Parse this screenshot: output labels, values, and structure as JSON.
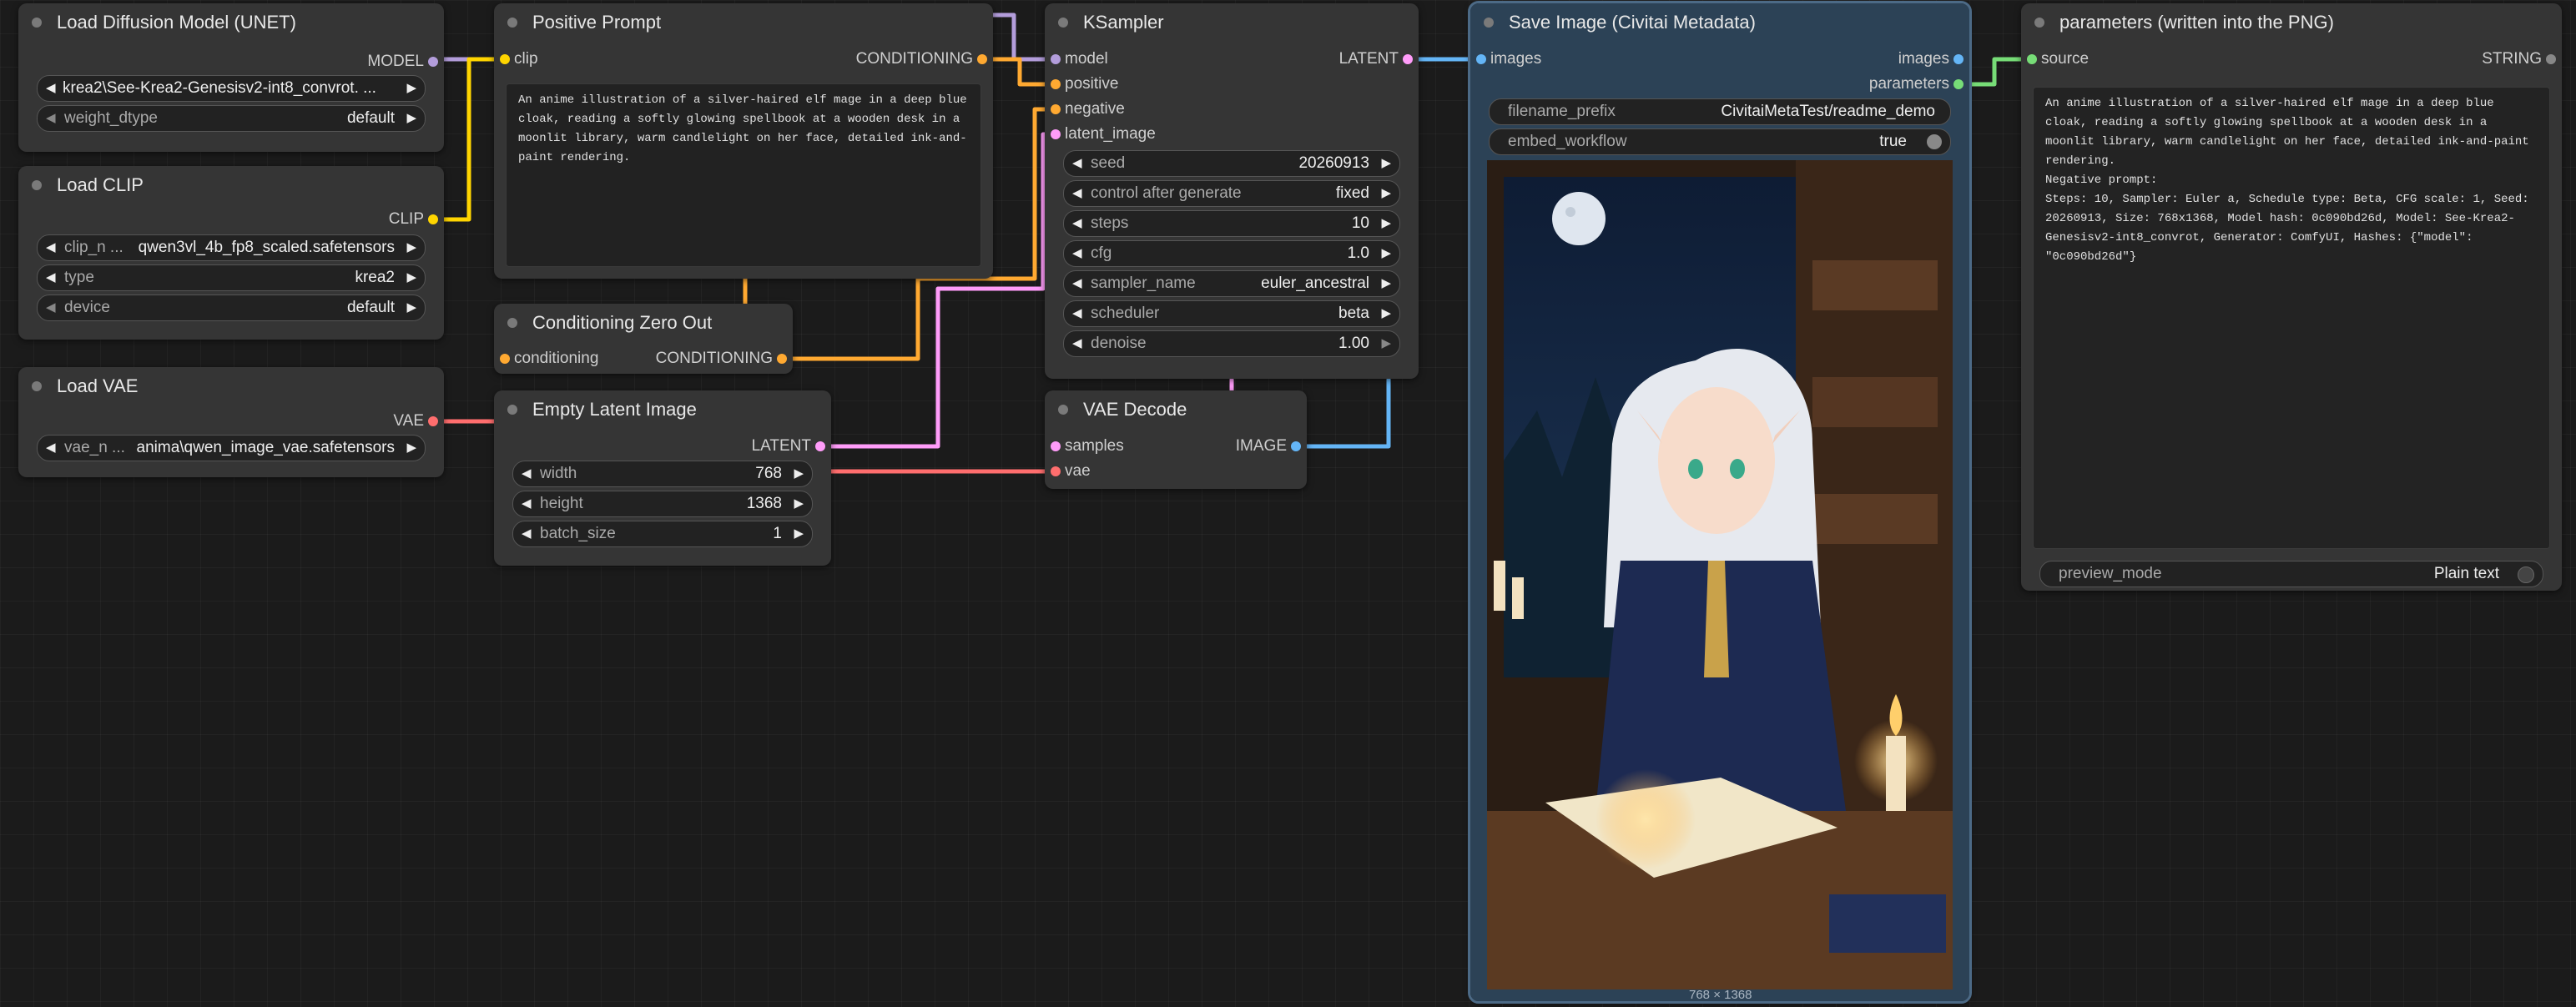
{
  "nodes": {
    "load_unet": {
      "title": "Load Diffusion Model (UNET)",
      "output": "MODEL",
      "unet_name": "krea2\\See-Krea2-Genesisv2-int8_convrot.  ...",
      "weight_dtype": {
        "label": "weight_dtype",
        "value": "default"
      }
    },
    "load_clip": {
      "title": "Load CLIP",
      "output": "CLIP",
      "clip_name": {
        "label": "clip_n ...",
        "value": "qwen3vl_4b_fp8_scaled.safetensors"
      },
      "type": {
        "label": "type",
        "value": "krea2"
      },
      "device": {
        "label": "device",
        "value": "default"
      }
    },
    "load_vae": {
      "title": "Load VAE",
      "output": "VAE",
      "vae_name": {
        "label": "vae_n ...",
        "value": "anima\\qwen_image_vae.safetensors"
      }
    },
    "positive_prompt": {
      "title": "Positive Prompt",
      "input": "clip",
      "output": "CONDITIONING",
      "text": "An anime illustration of a silver-haired elf mage in a deep blue cloak, reading a softly glowing spellbook at a wooden desk in a moonlit library, warm candlelight on her face, detailed ink-and-paint rendering."
    },
    "cond_zero": {
      "title": "Conditioning Zero Out",
      "input": "conditioning",
      "output": "CONDITIONING"
    },
    "empty_latent": {
      "title": "Empty Latent Image",
      "output": "LATENT",
      "width": {
        "label": "width",
        "value": "768"
      },
      "height": {
        "label": "height",
        "value": "1368"
      },
      "batch_size": {
        "label": "batch_size",
        "value": "1"
      }
    },
    "ksampler": {
      "title": "KSampler",
      "inputs": [
        "model",
        "positive",
        "negative",
        "latent_image"
      ],
      "output": "LATENT",
      "widgets": [
        {
          "label": "seed",
          "value": "20260913"
        },
        {
          "label": "control after generate",
          "value": "fixed"
        },
        {
          "label": "steps",
          "value": "10"
        },
        {
          "label": "cfg",
          "value": "1.0"
        },
        {
          "label": "sampler_name",
          "value": "euler_ancestral"
        },
        {
          "label": "scheduler",
          "value": "beta"
        },
        {
          "label": "denoise",
          "value": "1.00"
        }
      ]
    },
    "vae_decode": {
      "title": "VAE Decode",
      "inputs": [
        "samples",
        "vae"
      ],
      "output": "IMAGE"
    },
    "save_image": {
      "title": "Save Image (Civitai Metadata)",
      "input": "images",
      "outputs": [
        "images",
        "parameters"
      ],
      "filename_prefix": {
        "label": "filename_prefix",
        "value": "CivitaiMetaTest/readme_demo"
      },
      "embed_workflow": {
        "label": "embed_workflow",
        "value": "true"
      },
      "image_caption": "768 × 1368"
    },
    "parameters": {
      "title": "parameters (written into the PNG)",
      "input": "source",
      "output": "STRING",
      "text": "An anime illustration of a silver-haired elf mage in a deep blue cloak, reading a softly glowing spellbook at a wooden desk in a moonlit library, warm candlelight on her face, detailed ink-and-paint rendering.\nNegative prompt:\nSteps: 10, Sampler: Euler a, Schedule type: Beta, CFG scale: 1, Seed: 20260913, Size: 768x1368, Model hash: 0c090bd26d, Model: See-Krea2-Genesisv2-int8_convrot, Generator: ComfyUI, Hashes: {\"model\": \"0c090bd26d\"}",
      "preview_mode": {
        "label": "preview_mode",
        "value": "Plain text"
      }
    }
  },
  "colors": {
    "model": "#b39ddb",
    "clip": "#ffd500",
    "vae": "#ff6e6e",
    "conditioning": "#ffa931",
    "latent": "#ff9cf9",
    "image": "#64b5f6",
    "string": "#77dd77"
  }
}
